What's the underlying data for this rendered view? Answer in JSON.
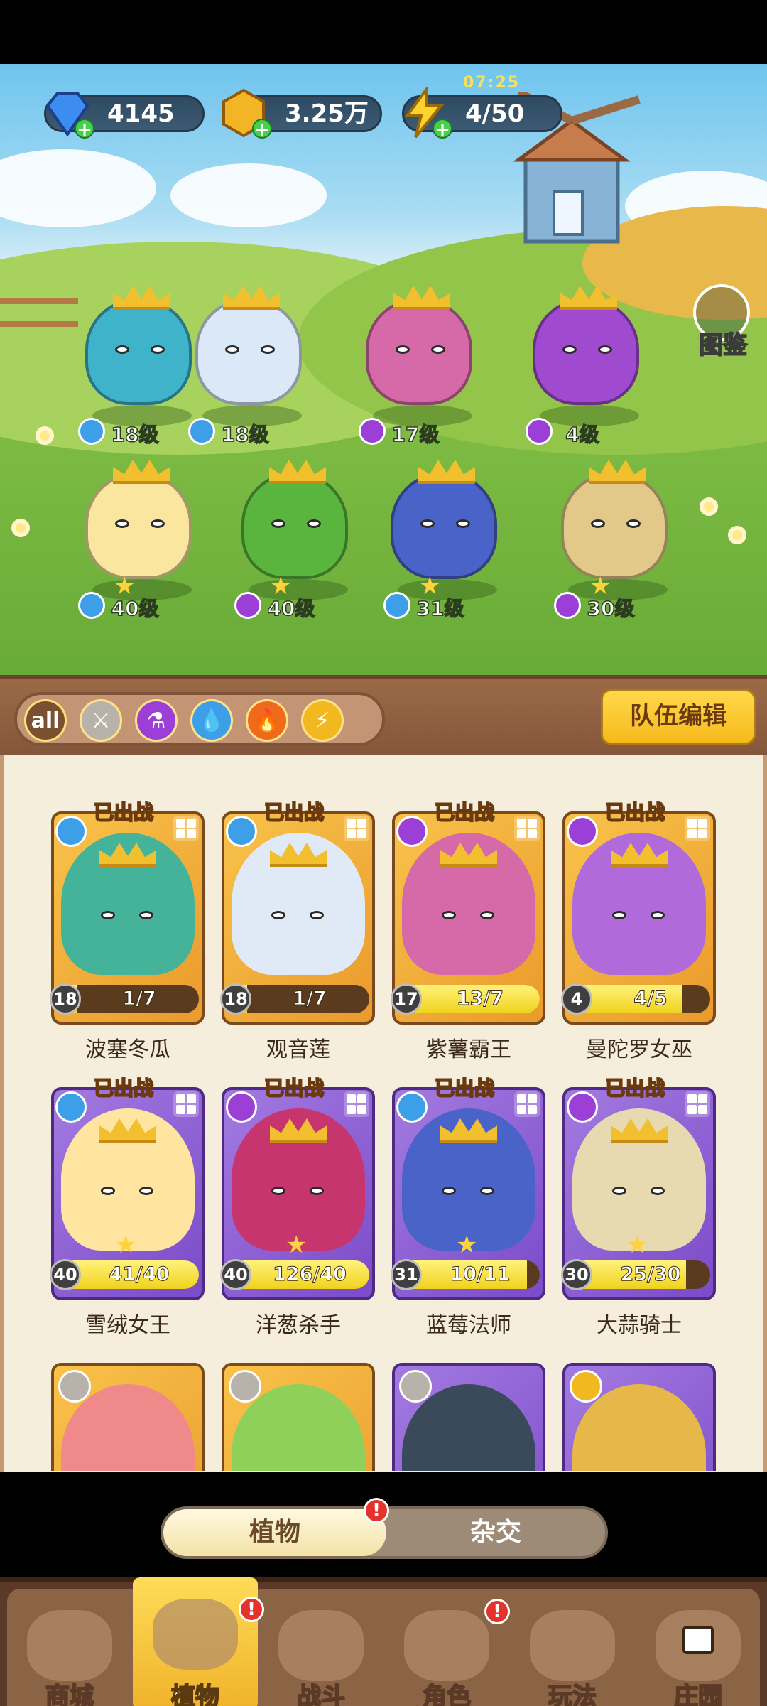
{
  "resources": {
    "diamonds": "4145",
    "gold": "3.25万",
    "energy": "4/50",
    "energy_timer": "07:25"
  },
  "codex_label": "图鉴",
  "lineup": [
    {
      "level": "18级",
      "element": "water"
    },
    {
      "level": "18级",
      "element": "water"
    },
    {
      "level": "17级",
      "element": "poison"
    },
    {
      "level": "4级",
      "element": "poison"
    },
    {
      "level": "40级",
      "element": "water"
    },
    {
      "level": "40级",
      "element": "poison"
    },
    {
      "level": "31级",
      "element": "water"
    },
    {
      "level": "30级",
      "element": "poison"
    }
  ],
  "filters": [
    "all",
    "sword",
    "poison",
    "water",
    "fire",
    "lightning"
  ],
  "team_edit_label": "队伍编辑",
  "deployed_label": "已出战",
  "cards": [
    {
      "name": "波塞冬瓜",
      "level": "18",
      "progress": "1/7",
      "fill": 0.14,
      "rarity": "gold",
      "element": "water"
    },
    {
      "name": "观音莲",
      "level": "18",
      "progress": "1/7",
      "fill": 0.14,
      "rarity": "gold",
      "element": "water"
    },
    {
      "name": "紫薯霸王",
      "level": "17",
      "progress": "13/7",
      "fill": 1.0,
      "rarity": "gold",
      "element": "poison"
    },
    {
      "name": "曼陀罗女巫",
      "level": "4",
      "progress": "4/5",
      "fill": 0.8,
      "rarity": "gold",
      "element": "poison"
    },
    {
      "name": "雪绒女王",
      "level": "40",
      "progress": "41/40",
      "fill": 1.0,
      "rarity": "purple",
      "element": "water"
    },
    {
      "name": "洋葱杀手",
      "level": "40",
      "progress": "126/40",
      "fill": 1.0,
      "rarity": "purple",
      "element": "poison"
    },
    {
      "name": "蓝莓法师",
      "level": "31",
      "progress": "10/11",
      "fill": 0.91,
      "rarity": "purple",
      "element": "water"
    },
    {
      "name": "大蒜骑士",
      "level": "30",
      "progress": "25/30",
      "fill": 0.83,
      "rarity": "purple",
      "element": "poison"
    }
  ],
  "toggle": {
    "plants": "植物",
    "hybrid": "杂交"
  },
  "nav": [
    "商城",
    "植物",
    "战斗",
    "角色",
    "玩法",
    "庄园"
  ],
  "badge_mark": "!",
  "colors": {
    "water": "#3c9fe8",
    "poison": "#9b3fd6",
    "fire": "#f06a1c",
    "lightning": "#f2b81f",
    "sword": "#b9b2aa"
  }
}
